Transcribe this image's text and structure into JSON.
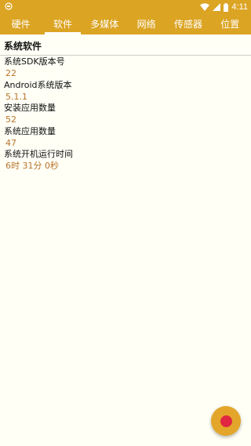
{
  "status_bar": {
    "time": "4:11",
    "app_icon": "android-debug-icon",
    "icons": [
      "wifi-icon",
      "signal-icon",
      "battery-icon"
    ]
  },
  "tabs": [
    {
      "label": "硬件",
      "active": false
    },
    {
      "label": "软件",
      "active": true
    },
    {
      "label": "多媒体",
      "active": false
    },
    {
      "label": "网络",
      "active": false
    },
    {
      "label": "传感器",
      "active": false
    },
    {
      "label": "位置",
      "active": false
    }
  ],
  "section": {
    "title": "系统软件"
  },
  "items": [
    {
      "label": "系统SDK版本号",
      "value": "22"
    },
    {
      "label": "Android系统版本",
      "value": "5.1.1"
    },
    {
      "label": "安装应用数量",
      "value": "52"
    },
    {
      "label": "系统应用数量",
      "value": "47"
    },
    {
      "label": "系统开机运行时间",
      "value": "6时 31分 0秒"
    }
  ],
  "fab": {
    "icon": "record-icon"
  },
  "colors": {
    "accent": "#dba423",
    "value_text": "#b8742a",
    "background": "#fffff6",
    "record": "#e02640"
  }
}
